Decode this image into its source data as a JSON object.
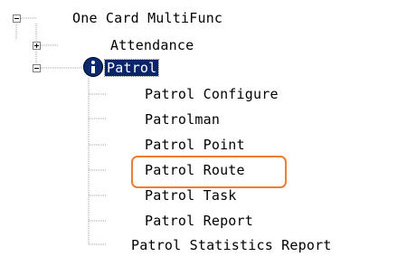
{
  "tree": {
    "root": {
      "label": "One Card MultiFunc"
    },
    "attendance": {
      "label": "Attendance"
    },
    "patrol": {
      "label": "Patrol",
      "icon": "info-icon",
      "children": [
        "Patrol Configure",
        "Patrolman",
        "Patrol Point",
        "Patrol Route",
        "Patrol Task",
        "Patrol Report",
        "Patrol Statistics Report"
      ]
    }
  },
  "style": {
    "selection_bg": "#0a246a",
    "highlight_border": "#ed7d31"
  }
}
